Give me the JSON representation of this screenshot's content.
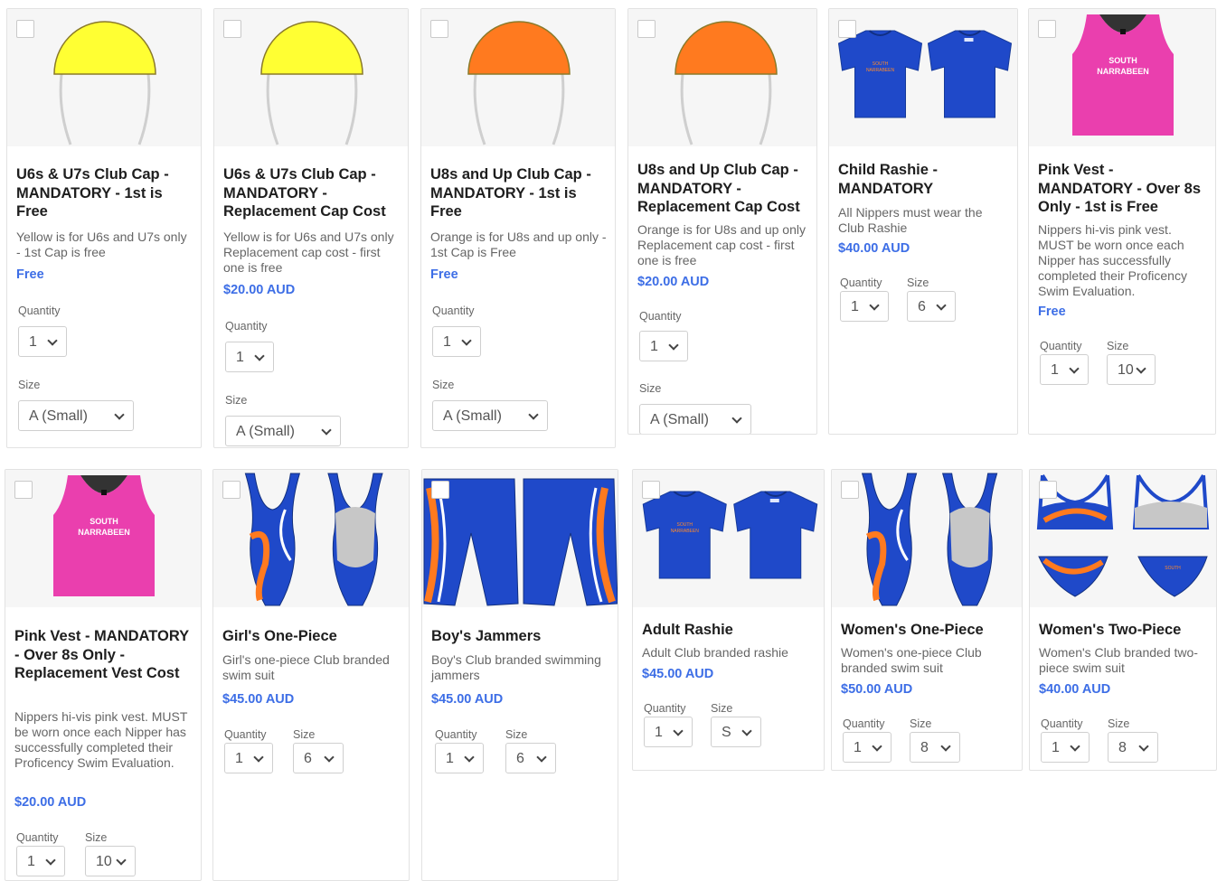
{
  "colors": {
    "accent": "#3d6ee6",
    "cap_yellow": "#ffff33",
    "cap_orange": "#ff7a1f",
    "club_blue": "#1f49c9",
    "vest_pink": "#ea3fae"
  },
  "labels": {
    "quantity": "Quantity",
    "size": "Size"
  },
  "vest_print": {
    "line1": "SOUTH",
    "line2": "NARRABEEN"
  },
  "products": [
    {
      "title": "U6s & U7s Club Cap - MANDATORY - 1st is Free",
      "description": "Yellow is for U6s and U7s only - 1st Cap is free",
      "price": "Free",
      "quantity": "1",
      "size": "A (Small)",
      "image": "yellow-cap"
    },
    {
      "title": "U6s & U7s Club Cap - MANDATORY - Replacement Cap Cost",
      "description": "Yellow is for U6s and U7s only Replacement cap cost - first one is free",
      "price": "$20.00 AUD",
      "quantity": "1",
      "size": "A (Small)",
      "image": "yellow-cap"
    },
    {
      "title": "U8s and Up Club Cap - MANDATORY - 1st is Free",
      "description": "Orange is for U8s and up only - 1st Cap is Free",
      "price": "Free",
      "quantity": "1",
      "size": "A (Small)",
      "image": "orange-cap"
    },
    {
      "title": "U8s and Up Club Cap - MANDATORY - Replacement Cap Cost",
      "description": "Orange is for U8s and up only Replacement cap cost - first one is free",
      "price": "$20.00 AUD",
      "quantity": "1",
      "size": "A (Small)",
      "image": "orange-cap"
    },
    {
      "title": "Child Rashie - MANDATORY",
      "description": "All Nippers must wear the Club Rashie",
      "price": "$40.00 AUD",
      "quantity": "1",
      "size": "6",
      "image": "rashie"
    },
    {
      "title": "Pink Vest - MANDATORY - Over 8s Only - 1st is Free",
      "description": "Nippers hi-vis pink vest. MUST be worn once each Nipper has successfully completed their Proficency Swim Evaluation.",
      "price": "Free",
      "quantity": "1",
      "size": "10",
      "image": "pink-vest"
    },
    {
      "title": "Pink Vest - MANDATORY - Over 8s Only - Replacement Vest Cost",
      "description": "Nippers hi-vis pink vest. MUST be worn once each Nipper has successfully completed their Proficency Swim Evaluation.",
      "price": "$20.00 AUD",
      "quantity": "1",
      "size": "10",
      "image": "pink-vest"
    },
    {
      "title": "Girl's One-Piece",
      "description": "Girl's one-piece Club branded swim suit",
      "price": "$45.00 AUD",
      "quantity": "1",
      "size": "6",
      "image": "one-piece"
    },
    {
      "title": "Boy's Jammers",
      "description": "Boy's Club branded swimming jammers",
      "price": "$45.00 AUD",
      "quantity": "1",
      "size": "6",
      "image": "jammers"
    },
    {
      "title": "Adult Rashie",
      "description": "Adult Club branded rashie",
      "price": "$45.00 AUD",
      "quantity": "1",
      "size": "S",
      "image": "rashie"
    },
    {
      "title": "Women's One-Piece",
      "description": "Women's one-piece Club branded swim suit",
      "price": "$50.00 AUD",
      "quantity": "1",
      "size": "8",
      "image": "one-piece"
    },
    {
      "title": "Women's Two-Piece",
      "description": "Women's Club branded two-piece swim suit",
      "price": "$40.00 AUD",
      "quantity": "1",
      "size": "8",
      "image": "two-piece"
    }
  ]
}
